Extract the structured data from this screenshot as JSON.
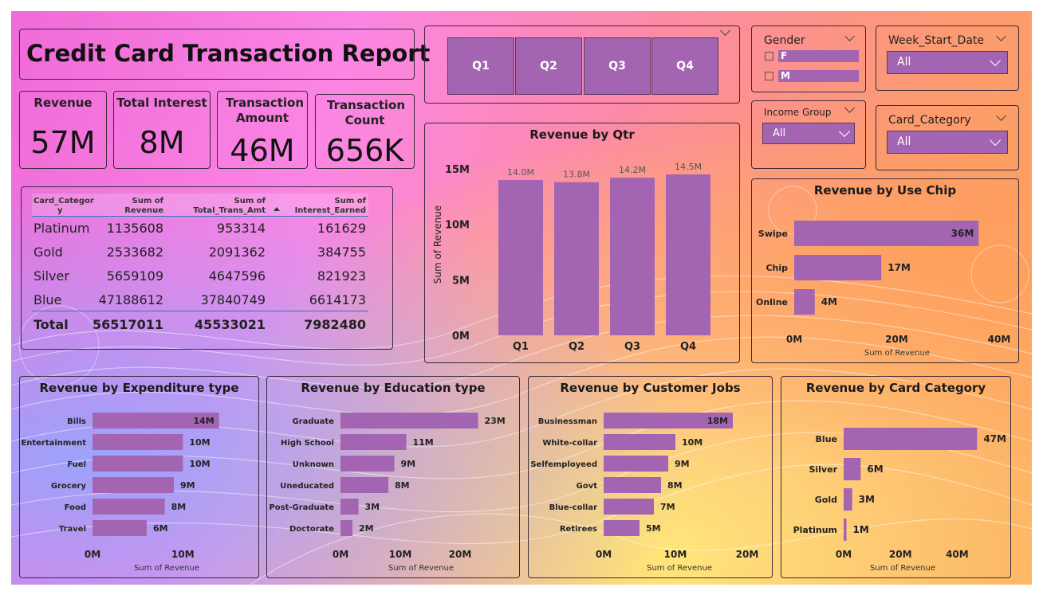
{
  "report_title": "Credit Card Transaction Report",
  "colors": {
    "bar": "#a365b1",
    "border": "#3a2a3a"
  },
  "kpis": [
    {
      "label": "Revenue",
      "value": "57M"
    },
    {
      "label": "Total Interest",
      "value": "8M"
    },
    {
      "label": "Transaction Amount",
      "value": "46M"
    },
    {
      "label": "Transaction Count",
      "value": "656K"
    }
  ],
  "quarter_slicer": {
    "buttons": [
      "Q1",
      "Q2",
      "Q3",
      "Q4"
    ]
  },
  "gender_slicer": {
    "title": "Gender",
    "options": [
      "F",
      "M"
    ]
  },
  "week_slicer": {
    "title": "Week_Start_Date",
    "value": "All"
  },
  "income_slicer": {
    "title": "Income Group",
    "value": "All"
  },
  "card_slicer": {
    "title": "Card_Category",
    "value": "All"
  },
  "table": {
    "headers": [
      "Card_Category",
      "Sum of Revenue",
      "Sum of Total_Trans_Amt",
      "Sum of Interest_Earned"
    ],
    "header_display": [
      [
        "Card_Categor",
        "y"
      ],
      [
        "Sum of",
        "Revenue"
      ],
      [
        "Sum of",
        "Total_Trans_Amt"
      ],
      [
        "Sum of",
        "Interest_Earned"
      ]
    ],
    "rows": [
      [
        "Platinum",
        "1135608",
        "953314",
        "161629"
      ],
      [
        "Gold",
        "2533682",
        "2091362",
        "384755"
      ],
      [
        "Silver",
        "5659109",
        "4647596",
        "821923"
      ],
      [
        "Blue",
        "47188612",
        "37840749",
        "6614173"
      ]
    ],
    "total": [
      "Total",
      "56517011",
      "45533021",
      "7982480"
    ]
  },
  "chart_data": [
    {
      "id": "qtr",
      "type": "bar",
      "title": "Revenue by Qtr",
      "categories": [
        "Q1",
        "Q2",
        "Q3",
        "Q4"
      ],
      "values": [
        14.0,
        13.8,
        14.2,
        14.5
      ],
      "data_labels": [
        "14.0M",
        "13.8M",
        "14.2M",
        "14.5M"
      ],
      "ylabel": "Sum of Revenue",
      "yticks": [
        "0M",
        "5M",
        "10M",
        "15M"
      ],
      "ylim": [
        0,
        15
      ],
      "unit": "M"
    },
    {
      "id": "chip",
      "type": "bar",
      "orientation": "horizontal",
      "title": "Revenue by Use Chip",
      "categories": [
        "Swipe",
        "Chip",
        "Online"
      ],
      "values": [
        36,
        17,
        4
      ],
      "data_labels": [
        "36M",
        "17M",
        "4M"
      ],
      "xlabel": "Sum of Revenue",
      "xticks": [
        "0M",
        "20M",
        "40M"
      ],
      "xlim": [
        0,
        40
      ]
    },
    {
      "id": "exp",
      "type": "bar",
      "orientation": "horizontal",
      "title": "Revenue by Expenditure type",
      "categories": [
        "Bills",
        "Entertainment",
        "Fuel",
        "Grocery",
        "Food",
        "Travel"
      ],
      "values": [
        14,
        10,
        10,
        9,
        8,
        6
      ],
      "data_labels": [
        "14M",
        "10M",
        "10M",
        "9M",
        "8M",
        "6M"
      ],
      "xlabel": "Sum of Revenue",
      "xticks": [
        "0M",
        "10M"
      ],
      "xlim": [
        0,
        15
      ]
    },
    {
      "id": "edu",
      "type": "bar",
      "orientation": "horizontal",
      "title": "Revenue by Education type",
      "categories": [
        "Graduate",
        "High School",
        "Unknown",
        "Uneducated",
        "Post-Graduate",
        "Doctorate"
      ],
      "values": [
        23,
        11,
        9,
        8,
        3,
        2
      ],
      "data_labels": [
        "23M",
        "11M",
        "9M",
        "8M",
        "3M",
        "2M"
      ],
      "xlabel": "Sum of Revenue",
      "xticks": [
        "0M",
        "10M",
        "20M"
      ],
      "xlim": [
        0,
        24
      ]
    },
    {
      "id": "jobs",
      "type": "bar",
      "orientation": "horizontal",
      "title": "Revenue by Customer Jobs",
      "categories": [
        "Businessman",
        "White-collar",
        "Selfemployeed",
        "Govt",
        "Blue-collar",
        "Retirees"
      ],
      "values": [
        18,
        10,
        9,
        8,
        7,
        5
      ],
      "data_labels": [
        "18M",
        "10M",
        "9M",
        "8M",
        "7M",
        "5M"
      ],
      "xlabel": "Sum of Revenue",
      "xticks": [
        "0M",
        "10M",
        "20M"
      ],
      "xlim": [
        0,
        20
      ]
    },
    {
      "id": "card",
      "type": "bar",
      "orientation": "horizontal",
      "title": "Revenue by Card Category",
      "categories": [
        "Blue",
        "Silver",
        "Gold",
        "Platinum"
      ],
      "values": [
        47,
        6,
        3,
        1
      ],
      "data_labels": [
        "47M",
        "6M",
        "3M",
        "1M"
      ],
      "xlabel": "Sum of Revenue",
      "xticks": [
        "0M",
        "20M",
        "40M"
      ],
      "xlim": [
        0,
        50
      ]
    }
  ]
}
